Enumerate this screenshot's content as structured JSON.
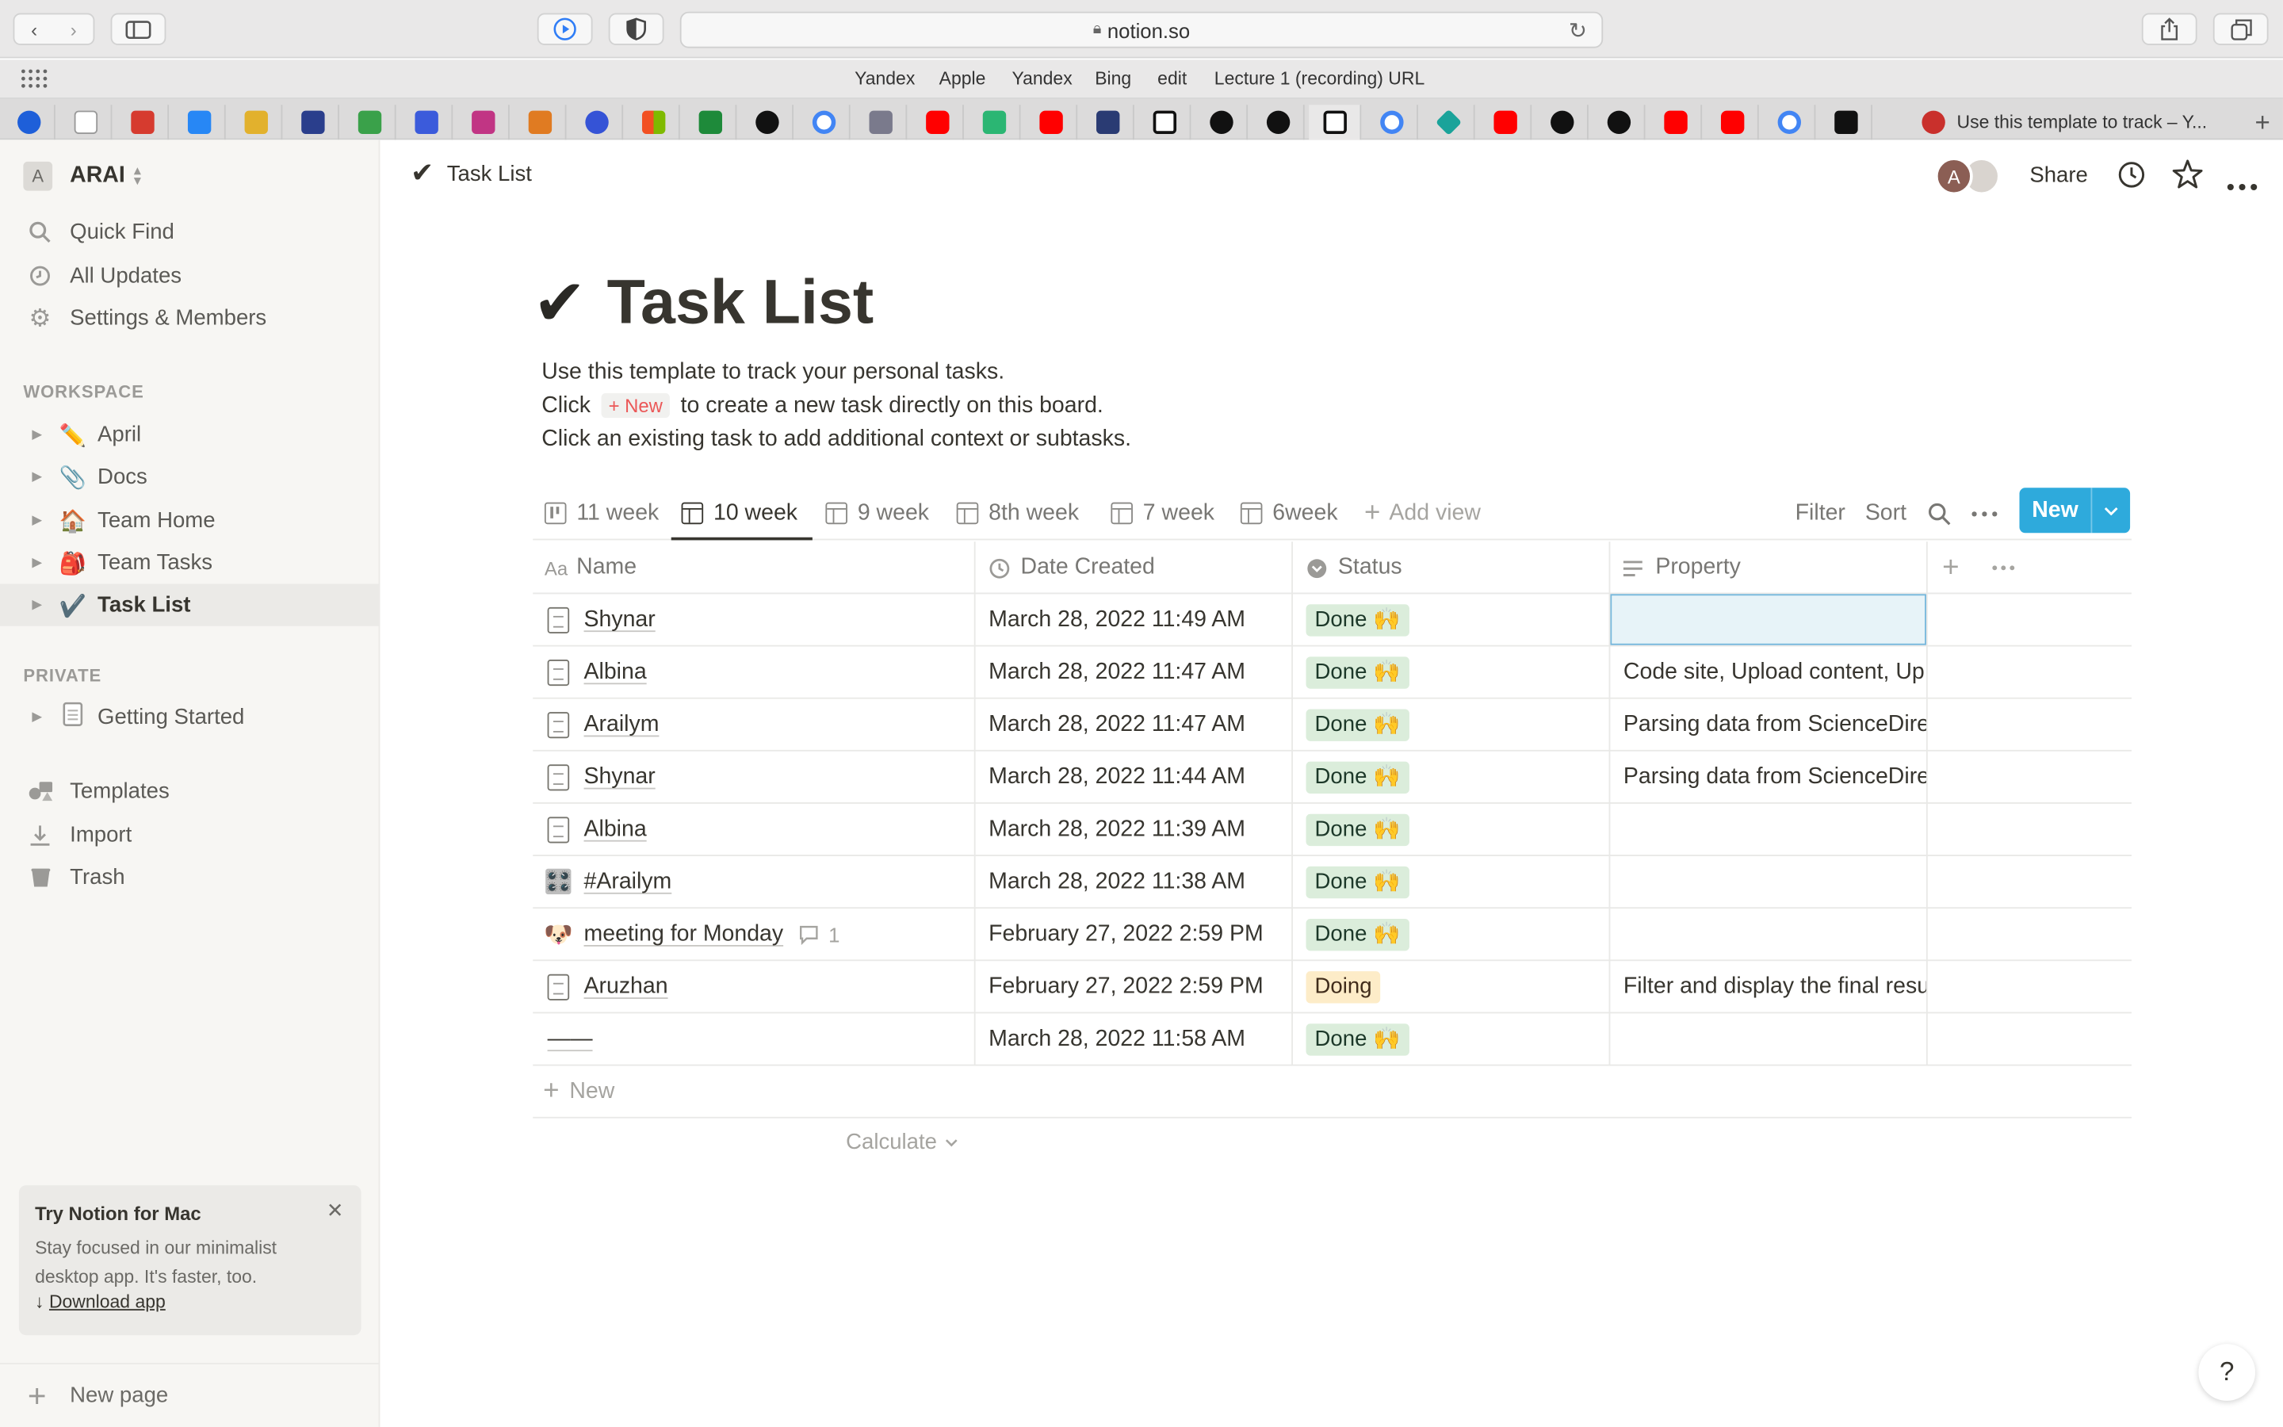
{
  "browser": {
    "url": "notion.so",
    "favorites": [
      "Yandex",
      "Apple",
      "Yandex",
      "Bing",
      "edit",
      "Lecture 1 (recording) URL"
    ],
    "active_tab_title": "Use this template to track – Y...",
    "new_tab_symbol": "+"
  },
  "workspace": {
    "initial": "A",
    "name": "ARAI"
  },
  "sidebar": {
    "top_items": [
      {
        "label": "Quick Find",
        "icon": "search-icon"
      },
      {
        "label": "All Updates",
        "icon": "clock-icon"
      },
      {
        "label": "Settings & Members",
        "icon": "gear-icon"
      }
    ],
    "workspace_section": "WORKSPACE",
    "workspace_pages": [
      {
        "emoji": "✏️",
        "label": "April"
      },
      {
        "emoji": "📎",
        "label": "Docs"
      },
      {
        "emoji": "🏠",
        "label": "Team Home"
      },
      {
        "emoji": "🎒",
        "label": "Team Tasks"
      },
      {
        "emoji": "✔️",
        "label": "Task List"
      }
    ],
    "private_section": "PRIVATE",
    "private_pages": [
      {
        "emoji": "📄",
        "label": "Getting Started"
      }
    ],
    "bottom_items": [
      {
        "label": "Templates",
        "icon": "templates-icon"
      },
      {
        "label": "Import",
        "icon": "import-icon"
      },
      {
        "label": "Trash",
        "icon": "trash-icon"
      }
    ],
    "promo": {
      "title": "Try Notion for Mac",
      "body": "Stay focused in our minimalist desktop app. It's faster, too.",
      "link": "Download app",
      "close": "✕"
    },
    "new_page": "New page"
  },
  "topbar": {
    "breadcrumb_icon": "✔",
    "breadcrumb": "Task List",
    "avatar_initial": "A",
    "share": "Share"
  },
  "page": {
    "icon": "✔",
    "title": "Task List",
    "desc_line1": "Use this template to track your personal tasks.",
    "desc_line2_pre": "Click",
    "desc_line2_chip": "+ New",
    "desc_line2_post": "to create a new task directly on this board.",
    "desc_line3": "Click an existing task to add additional context or subtasks."
  },
  "views": {
    "tabs": [
      {
        "label": "11 week",
        "type": "board"
      },
      {
        "label": "10 week",
        "type": "table",
        "active": true
      },
      {
        "label": "9 week",
        "type": "table"
      },
      {
        "label": "8th week",
        "type": "table"
      },
      {
        "label": "7 week",
        "type": "table"
      },
      {
        "label": "6week",
        "type": "table"
      }
    ],
    "add_view": "Add view",
    "filter": "Filter",
    "sort": "Sort",
    "new_button": "New"
  },
  "table": {
    "columns": [
      "Name",
      "Date Created",
      "Status",
      "Property"
    ],
    "rows": [
      {
        "icon": "doc",
        "name": "Shynar",
        "date": "March 28, 2022 11:49 AM",
        "status": "Done 🙌",
        "status_type": "done",
        "property": ""
      },
      {
        "icon": "doc",
        "name": "Albina",
        "date": "March 28, 2022 11:47 AM",
        "status": "Done 🙌",
        "status_type": "done",
        "property": "Code site, Upload content, Up"
      },
      {
        "icon": "doc",
        "name": "Arailym",
        "date": "March 28, 2022 11:47 AM",
        "status": "Done 🙌",
        "status_type": "done",
        "property": "Parsing data from ScienceDire"
      },
      {
        "icon": "doc",
        "name": "Shynar",
        "date": "March 28, 2022 11:44 AM",
        "status": "Done 🙌",
        "status_type": "done",
        "property": "Parsing data from ScienceDire"
      },
      {
        "icon": "doc",
        "name": "Albina",
        "date": "March 28, 2022 11:39 AM",
        "status": "Done 🙌",
        "status_type": "done",
        "property": ""
      },
      {
        "icon": "🎛️",
        "name": "#Arailym",
        "date": "March 28, 2022 11:38 AM",
        "status": "Done 🙌",
        "status_type": "done",
        "property": ""
      },
      {
        "icon": "🐶",
        "name": "meeting for Monday",
        "comments": "1",
        "date": "February 27, 2022 2:59 PM",
        "status": "Done 🙌",
        "status_type": "done",
        "property": ""
      },
      {
        "icon": "doc",
        "name": "Aruzhan",
        "date": "February 27, 2022 2:59 PM",
        "status": "Doing",
        "status_type": "doing",
        "property": "Filter and display the final resu"
      },
      {
        "icon": "none",
        "name": "——",
        "date": "March 28, 2022 11:58 AM",
        "status": "Done 🙌",
        "status_type": "done",
        "property": ""
      }
    ],
    "new_row": "New",
    "calculate": "Calculate"
  },
  "help": "?",
  "colors": {
    "accent": "#2eaadc",
    "sidebar_bg": "#f7f6f3",
    "done_bg": "#dbeddb",
    "doing_bg": "#fdecc8"
  }
}
